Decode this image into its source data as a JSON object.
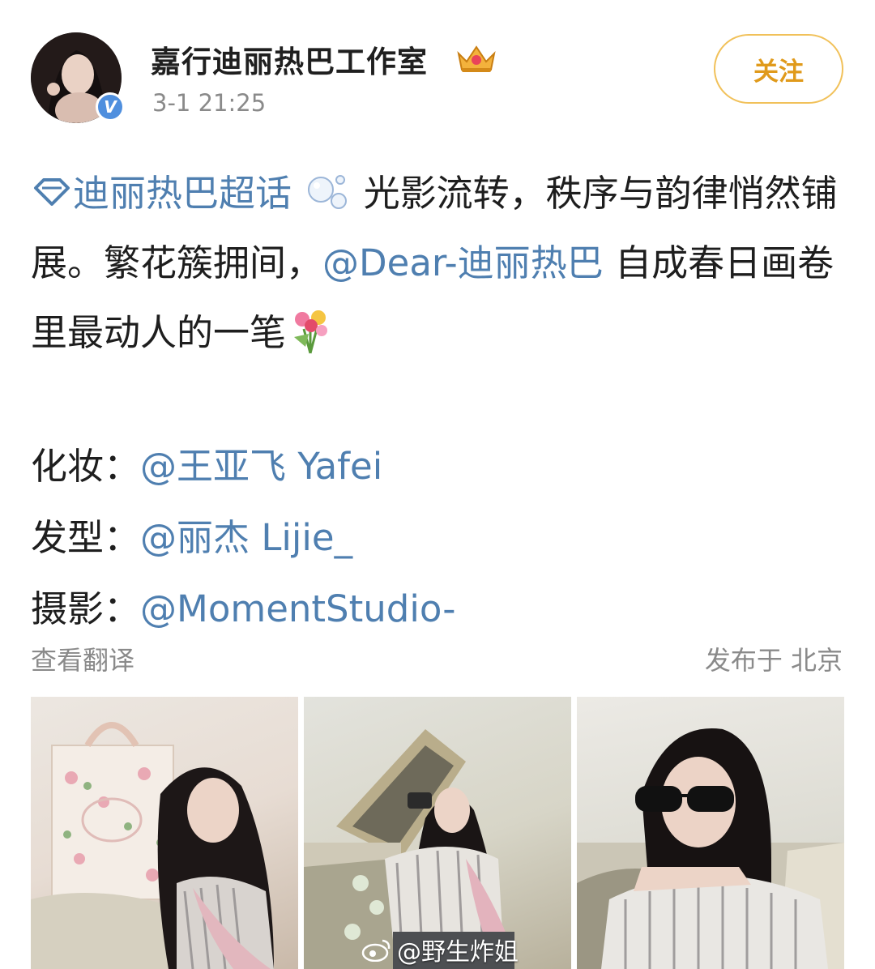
{
  "post": {
    "author": {
      "name": "嘉行迪丽热巴工作室",
      "verified_mark": "V",
      "crown_icon": "crown-badge-icon"
    },
    "timestamp": "3-1 21:25",
    "follow_label": "关注",
    "supertopic": "迪丽热巴超话",
    "text_part1": "光影流转，秩序与韵律悄然铺展。繁花簇拥间，",
    "mention_main": "@Dear-迪丽热巴",
    "text_part2": " 自成春日画卷里最动人的一笔",
    "credits": [
      {
        "label": "化妆：",
        "mention": "@王亚飞 Yafei"
      },
      {
        "label": "发型：",
        "mention": "@丽杰 Lijie_"
      },
      {
        "label": "摄影：",
        "mention": "@MomentStudio-"
      }
    ],
    "translate_label": "查看翻译",
    "location_label": "发布于 北京",
    "photos": [
      "photo-1",
      "photo-2",
      "photo-3"
    ],
    "watermark": "@野生炸姐"
  },
  "colors": {
    "link": "#4f7fb0",
    "follow": "#e09a1b",
    "follow_border": "#f1c15a",
    "meta": "#8a8a8a",
    "verified": "#4f8fde"
  }
}
